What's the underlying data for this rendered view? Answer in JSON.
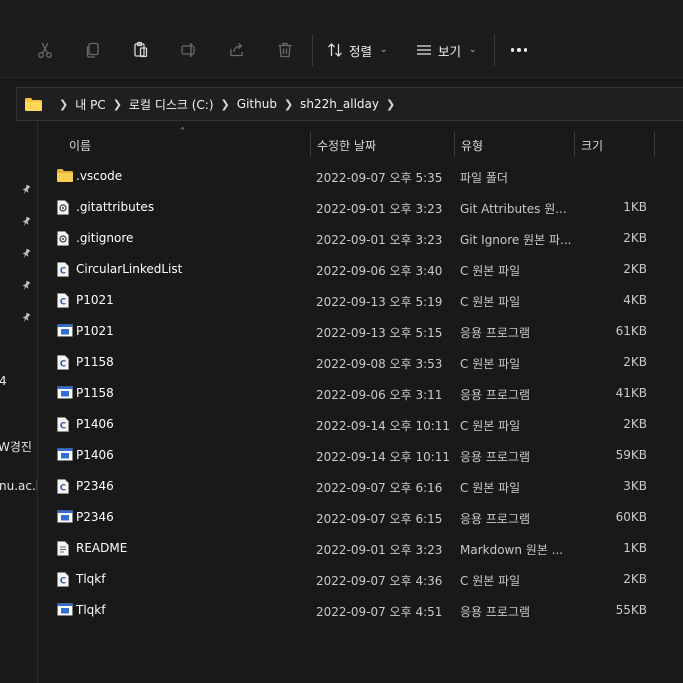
{
  "toolbar": {
    "cut_icon": "scissors-icon",
    "copy_icon": "copy-icon",
    "paste_icon": "clipboard-icon",
    "rename_icon": "rename-icon",
    "share_icon": "share-icon",
    "delete_icon": "trash-icon",
    "sort_label": "정렬",
    "view_label": "보기",
    "more_icon": "more-icon"
  },
  "address": {
    "crumbs": [
      "내 PC",
      "로컬 디스크 (C:)",
      "Github",
      "sh22h_allday"
    ]
  },
  "nav": {
    "fragments": [
      "4",
      "W경진",
      "nu.ac.k"
    ]
  },
  "columns": {
    "name": "이름",
    "date": "수정한 날짜",
    "type": "유형",
    "size": "크기"
  },
  "files": [
    {
      "name": ".vscode",
      "date": "2022-09-07 오후 5:35",
      "type": "파일 폴더",
      "size": "",
      "icon": "folder"
    },
    {
      "name": ".gitattributes",
      "date": "2022-09-01 오후 3:23",
      "type": "Git Attributes 원...",
      "size": "1KB",
      "icon": "config"
    },
    {
      "name": ".gitignore",
      "date": "2022-09-01 오후 3:23",
      "type": "Git Ignore 원본 파...",
      "size": "2KB",
      "icon": "config"
    },
    {
      "name": "CircularLinkedList",
      "date": "2022-09-06 오후 3:40",
      "type": "C 원본 파일",
      "size": "2KB",
      "icon": "c"
    },
    {
      "name": "P1021",
      "date": "2022-09-13 오후 5:19",
      "type": "C 원본 파일",
      "size": "4KB",
      "icon": "c"
    },
    {
      "name": "P1021",
      "date": "2022-09-13 오후 5:15",
      "type": "응용 프로그램",
      "size": "61KB",
      "icon": "exe"
    },
    {
      "name": "P1158",
      "date": "2022-09-08 오후 3:53",
      "type": "C 원본 파일",
      "size": "2KB",
      "icon": "c"
    },
    {
      "name": "P1158",
      "date": "2022-09-06 오후 3:11",
      "type": "응용 프로그램",
      "size": "41KB",
      "icon": "exe"
    },
    {
      "name": "P1406",
      "date": "2022-09-14 오후 10:11",
      "type": "C 원본 파일",
      "size": "2KB",
      "icon": "c"
    },
    {
      "name": "P1406",
      "date": "2022-09-14 오후 10:11",
      "type": "응용 프로그램",
      "size": "59KB",
      "icon": "exe"
    },
    {
      "name": "P2346",
      "date": "2022-09-07 오후 6:16",
      "type": "C 원본 파일",
      "size": "3KB",
      "icon": "c"
    },
    {
      "name": "P2346",
      "date": "2022-09-07 오후 6:15",
      "type": "응용 프로그램",
      "size": "60KB",
      "icon": "exe"
    },
    {
      "name": "README",
      "date": "2022-09-01 오후 3:23",
      "type": "Markdown 원본 ...",
      "size": "1KB",
      "icon": "doc"
    },
    {
      "name": "Tlqkf",
      "date": "2022-09-07 오후 4:36",
      "type": "C 원본 파일",
      "size": "2KB",
      "icon": "c"
    },
    {
      "name": "Tlqkf",
      "date": "2022-09-07 오후 4:51",
      "type": "응용 프로그램",
      "size": "55KB",
      "icon": "exe"
    }
  ],
  "colors": {
    "background": "#191919",
    "folder": "#f4c542",
    "exe_blue": "#2f6fd6"
  }
}
